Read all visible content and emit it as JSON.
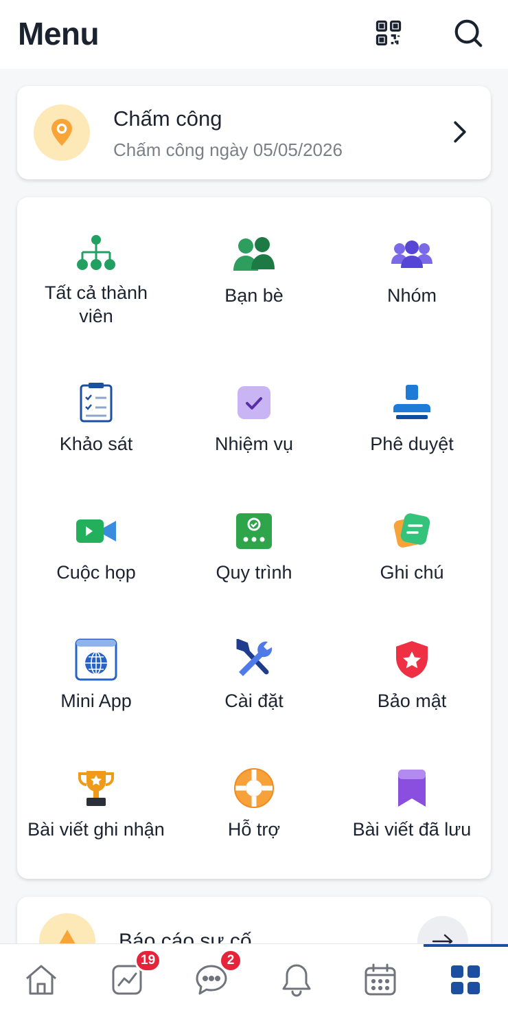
{
  "header": {
    "title": "Menu",
    "qr_icon": "qr-code-icon",
    "search_icon": "search-icon"
  },
  "attendance": {
    "title": "Chấm công",
    "subtitle": "Chấm công ngày 05/05/2026",
    "icon": "location-pin-icon",
    "accent": "#f7a536"
  },
  "grid": {
    "items": [
      {
        "label": "Tất cả thành viên",
        "icon": "org-tree-icon"
      },
      {
        "label": "Bạn bè",
        "icon": "friends-icon"
      },
      {
        "label": "Nhóm",
        "icon": "group-icon"
      },
      {
        "label": "Khảo sát",
        "icon": "survey-icon"
      },
      {
        "label": "Nhiệm vụ",
        "icon": "task-check-icon"
      },
      {
        "label": "Phê duyệt",
        "icon": "approval-stamp-icon"
      },
      {
        "label": "Cuộc họp",
        "icon": "video-meeting-icon"
      },
      {
        "label": "Quy trình",
        "icon": "workflow-icon"
      },
      {
        "label": "Ghi chú",
        "icon": "note-icon"
      },
      {
        "label": "Mini App",
        "icon": "globe-window-icon"
      },
      {
        "label": "Cài đặt",
        "icon": "tools-icon"
      },
      {
        "label": "Bảo mật",
        "icon": "shield-star-icon"
      },
      {
        "label": "Bài viết ghi nhận",
        "icon": "trophy-icon"
      },
      {
        "label": "Hỗ trợ",
        "icon": "lifebuoy-icon"
      },
      {
        "label": "Bài viết đã lưu",
        "icon": "bookmark-icon"
      }
    ]
  },
  "report": {
    "title": "Báo cáo sự cố",
    "icon": "warning-icon",
    "arrow_icon": "arrow-right-icon"
  },
  "tabbar": {
    "tabs": [
      {
        "name": "home",
        "icon": "home-icon"
      },
      {
        "name": "activity",
        "icon": "chart-icon",
        "badge": "19"
      },
      {
        "name": "messages",
        "icon": "chat-icon",
        "badge": "2"
      },
      {
        "name": "notifications",
        "icon": "bell-icon"
      },
      {
        "name": "calendar",
        "icon": "calendar-icon"
      },
      {
        "name": "menu",
        "icon": "grid-icon",
        "active": true
      }
    ],
    "active_color": "#1d4fa0"
  }
}
